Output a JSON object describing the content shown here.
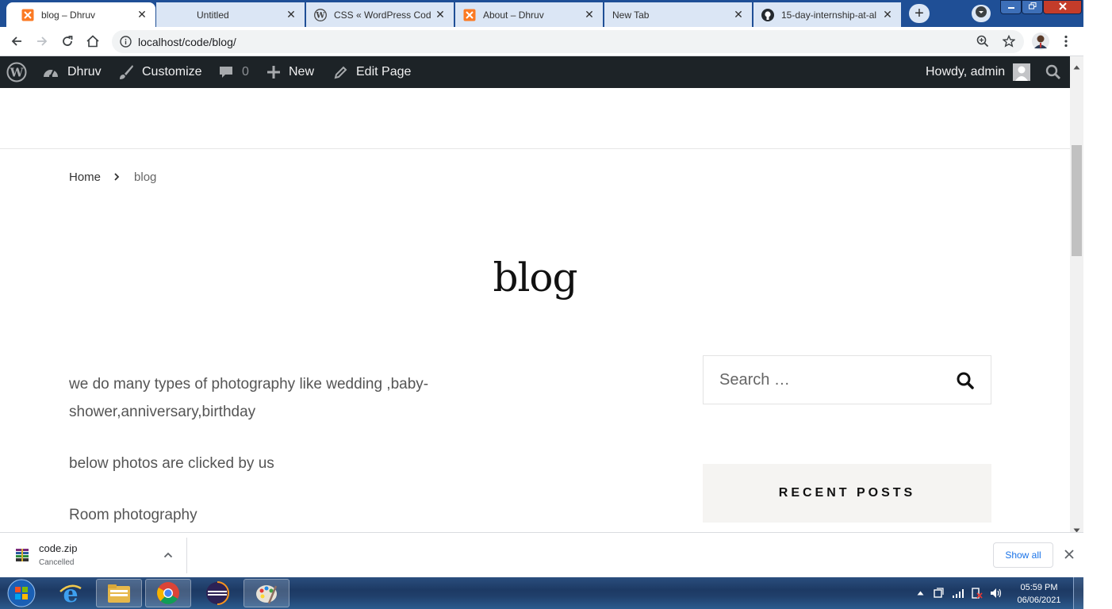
{
  "browser": {
    "tabs": [
      {
        "label": "blog – Dhruv",
        "active": true,
        "icon": "xampp-icon"
      },
      {
        "label": "Untitled",
        "active": false,
        "icon": ""
      },
      {
        "label": "CSS « WordPress Code",
        "active": false,
        "icon": "wordpress-icon"
      },
      {
        "label": "About – Dhruv",
        "active": false,
        "icon": "xampp-icon"
      },
      {
        "label": "New Tab",
        "active": false,
        "icon": ""
      },
      {
        "label": "15-day-internship-at-al",
        "active": false,
        "icon": "github-icon"
      }
    ],
    "url": "localhost/code/blog/",
    "new_tab_symbol": "+",
    "close_symbol": "✕"
  },
  "admin_bar": {
    "site_name": "Dhruv",
    "customize": "Customize",
    "comments_count": "0",
    "new": "New",
    "edit_page": "Edit Page",
    "howdy": "Howdy, admin"
  },
  "page": {
    "breadcrumb": {
      "home": "Home",
      "current": "blog"
    },
    "title": "blog",
    "paragraphs": [
      "we do many types of photography like wedding ,baby-shower,anniversary,birthday",
      "below photos are clicked by us",
      "Room photography"
    ],
    "search": {
      "placeholder": "Search …"
    },
    "recent_posts_heading": "RECENT POSTS"
  },
  "downloads": {
    "file_name": "code.zip",
    "status": "Cancelled",
    "show_all": "Show all"
  },
  "taskbar": {
    "time": "05:59 PM",
    "date": "06/06/2021"
  },
  "colors": {
    "tabstrip": "#1f4f96",
    "admin_bar": "#1d2327",
    "link_blue": "#1a73e8"
  }
}
